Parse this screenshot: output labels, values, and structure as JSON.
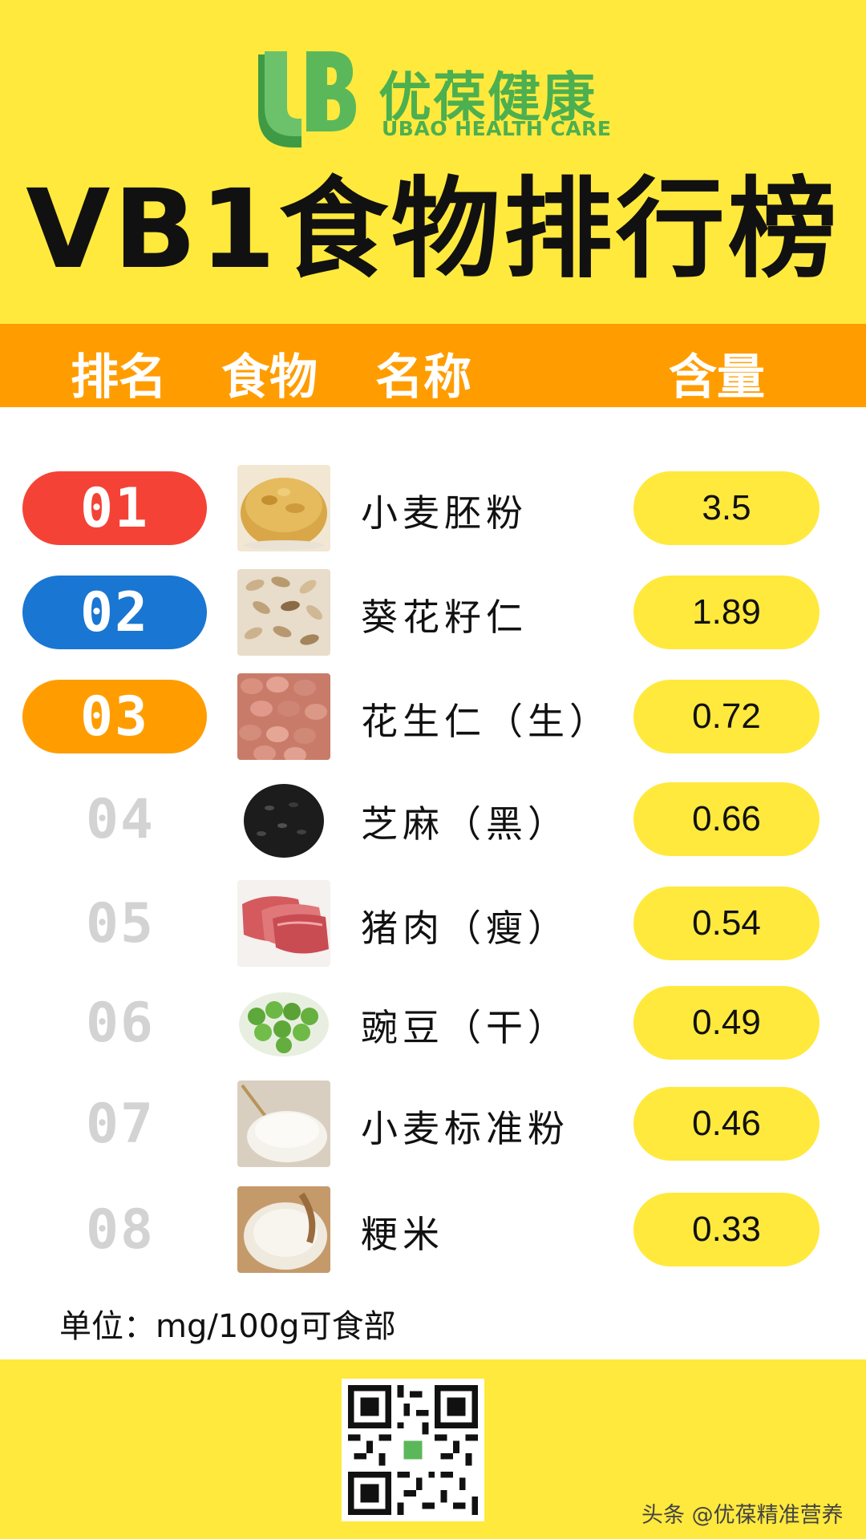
{
  "logo": {
    "mark_text": "UB",
    "name_cn": "优葆健康",
    "name_en": "UBAO HEALTH CARE"
  },
  "title": "VB1食物排行榜",
  "columns": {
    "rank": "排名",
    "food": "食物",
    "name": "名称",
    "content": "含量"
  },
  "rows": [
    {
      "rank": "01",
      "name": "小麦胚粉",
      "value": "3.5",
      "image_icon": "wheat-germ-flour-photo",
      "rank_color": "#f44336"
    },
    {
      "rank": "02",
      "name": "葵花籽仁",
      "value": "1.89",
      "image_icon": "sunflower-seed-kernel-photo",
      "rank_color": "#1976d2"
    },
    {
      "rank": "03",
      "name": "花生仁（生）",
      "value": "0.72",
      "image_icon": "raw-peanut-photo",
      "rank_color": "#ff9d00"
    },
    {
      "rank": "04",
      "name": "芝麻（黑）",
      "value": "0.66",
      "image_icon": "black-sesame-photo"
    },
    {
      "rank": "05",
      "name": "猪肉（瘦）",
      "value": "0.54",
      "image_icon": "lean-pork-photo"
    },
    {
      "rank": "06",
      "name": "豌豆（干）",
      "value": "0.49",
      "image_icon": "dried-pea-photo"
    },
    {
      "rank": "07",
      "name": "小麦标准粉",
      "value": "0.46",
      "image_icon": "standard-wheat-flour-photo"
    },
    {
      "rank": "08",
      "name": "粳米",
      "value": "0.33",
      "image_icon": "japonica-rice-photo"
    }
  ],
  "unit": "单位：mg/100g可食部",
  "watermark": "头条 @优葆精准营养",
  "colors": {
    "yellow": "#ffe93d",
    "orange": "#ff9d00",
    "brand_green": "#4caf50",
    "rank_gray": "#d3d3d3"
  }
}
